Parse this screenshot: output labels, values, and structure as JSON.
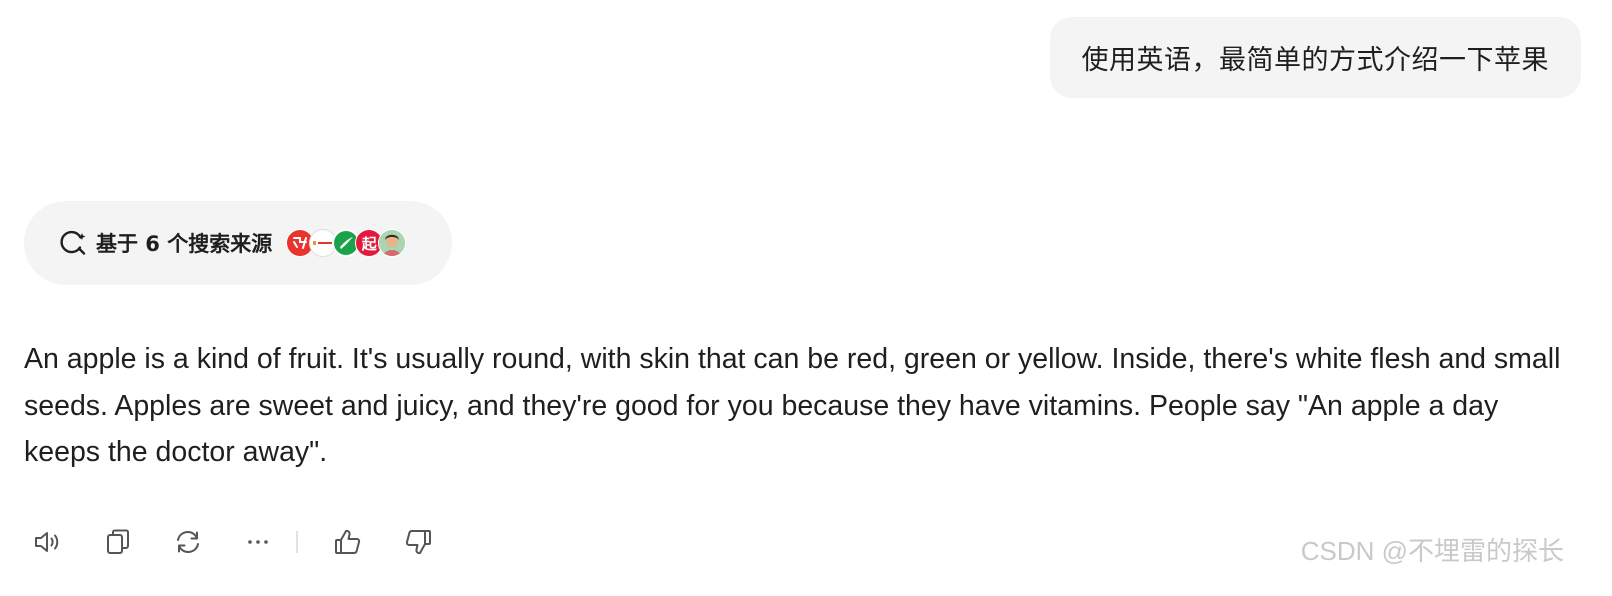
{
  "user_message": {
    "text": "使用英语，最简单的方式介绍一下苹果"
  },
  "sources": {
    "label": "基于 6 个搜索来源",
    "icons": [
      {
        "name": "source-1-icon",
        "color": "#e8342c",
        "glyph": "ʯ"
      },
      {
        "name": "source-2-icon",
        "color": "#ffffff",
        "glyph": "·"
      },
      {
        "name": "source-3-icon",
        "color": "#1aa34a",
        "glyph": "✓"
      },
      {
        "name": "source-4-icon",
        "color": "#e21b3c",
        "glyph": "起"
      },
      {
        "name": "source-5-icon",
        "color": "#7fb98a",
        "glyph": ""
      }
    ]
  },
  "answer": {
    "text": "An apple is a kind of fruit. It's usually round, with skin that can be red, green or yellow. Inside, there's white flesh and small seeds. Apples are sweet and juicy, and they're good for you because they have vitamins. People say \"An apple a day keeps the doctor away\"."
  },
  "actions": {
    "items": [
      "speaker-icon",
      "copy-icon",
      "regenerate-icon",
      "more-icon",
      "thumbs-up-icon",
      "thumbs-down-icon"
    ]
  },
  "watermark": {
    "text": "CSDN @不埋雷的探长"
  }
}
